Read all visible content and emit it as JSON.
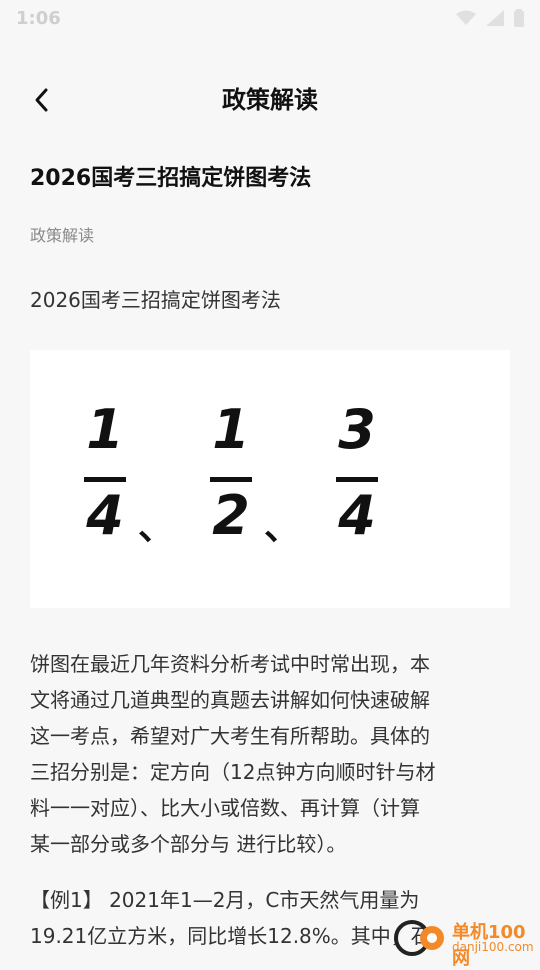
{
  "status_bar": {
    "time": "1:06",
    "icons": [
      "wifi-icon",
      "signal-icon",
      "battery-icon"
    ]
  },
  "header": {
    "back_icon": "chevron-left-icon",
    "title": "政策解读"
  },
  "article": {
    "title": "2026国考三招搞定饼图考法",
    "category": "政策解读",
    "lead": "2026国考三招搞定饼图考法",
    "image_fractions": [
      {
        "numerator": "1",
        "denominator": "4",
        "separator": "、"
      },
      {
        "numerator": "1",
        "denominator": "2",
        "separator": "、"
      },
      {
        "numerator": "3",
        "denominator": "4",
        "separator": ""
      }
    ],
    "body_lines": [
      "饼图在最近几年资料分析考试中时常出现，本",
      "文将通过几道典型的真题去讲解如何快速破解",
      "这一考点，希望对广大考生有所帮助。具体的",
      "三招分别是：定方向（12点钟方向顺时针与材",
      "料一一对应）、比大小或倍数、再计算（计算",
      "某一部分或多个部分与 进行比较）。"
    ],
    "example_lines": [
      "【例1】 2021年1—2月，C市天然气用量为",
      "19.21亿立方米，同比增长12.8%。其中，石"
    ]
  },
  "watermark": {
    "text": "单机100网",
    "sub": "danji100.com"
  }
}
